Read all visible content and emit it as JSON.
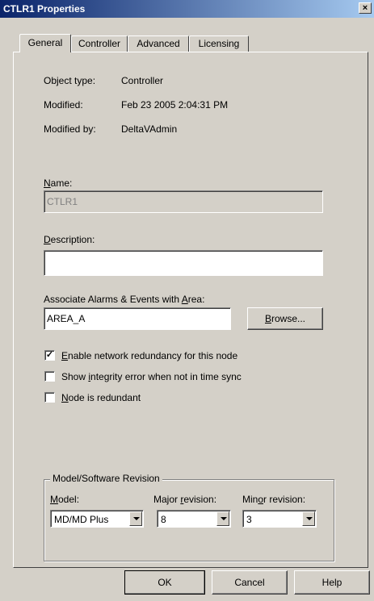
{
  "window": {
    "title": "CTLR1 Properties",
    "close_label": "×"
  },
  "tabs": [
    "General",
    "Controller",
    "Advanced",
    "Licensing"
  ],
  "info": {
    "object_type_label": "Object type:",
    "object_type_value": "Controller",
    "modified_label": "Modified:",
    "modified_value": "Feb 23 2005 2:04:31 PM",
    "modified_by_label": "Modified by:",
    "modified_by_value": "DeltaVAdmin"
  },
  "name": {
    "label_ul": "N",
    "label_rest": "ame:",
    "value": "CTLR1"
  },
  "description": {
    "label_ul": "D",
    "label_rest": "escription:",
    "value": ""
  },
  "area": {
    "label_pre": "Associate Alarms & Events with ",
    "label_ul": "A",
    "label_post": "rea:",
    "value": "AREA_A",
    "browse_ul": "B",
    "browse_rest": "rowse..."
  },
  "checkboxes": [
    {
      "pre": "",
      "ul": "E",
      "post": "nable network redundancy for this node",
      "checked": true
    },
    {
      "pre": "Show ",
      "ul": "i",
      "post": "ntegrity error when not in time sync",
      "checked": false
    },
    {
      "pre": "",
      "ul": "N",
      "post": "ode is redundant",
      "checked": false
    }
  ],
  "revision": {
    "group_label": "Model/Software Revision",
    "model_label_ul": "M",
    "model_label_rest": "odel:",
    "model_value": "MD/MD Plus",
    "major_label_pre": "Major ",
    "major_label_ul": "r",
    "major_label_post": "evision:",
    "major_value": "8",
    "minor_label_pre": "Min",
    "minor_label_ul": "o",
    "minor_label_post": "r revision:",
    "minor_value": "3"
  },
  "footer": {
    "ok": "OK",
    "cancel": "Cancel",
    "help": "Help"
  }
}
